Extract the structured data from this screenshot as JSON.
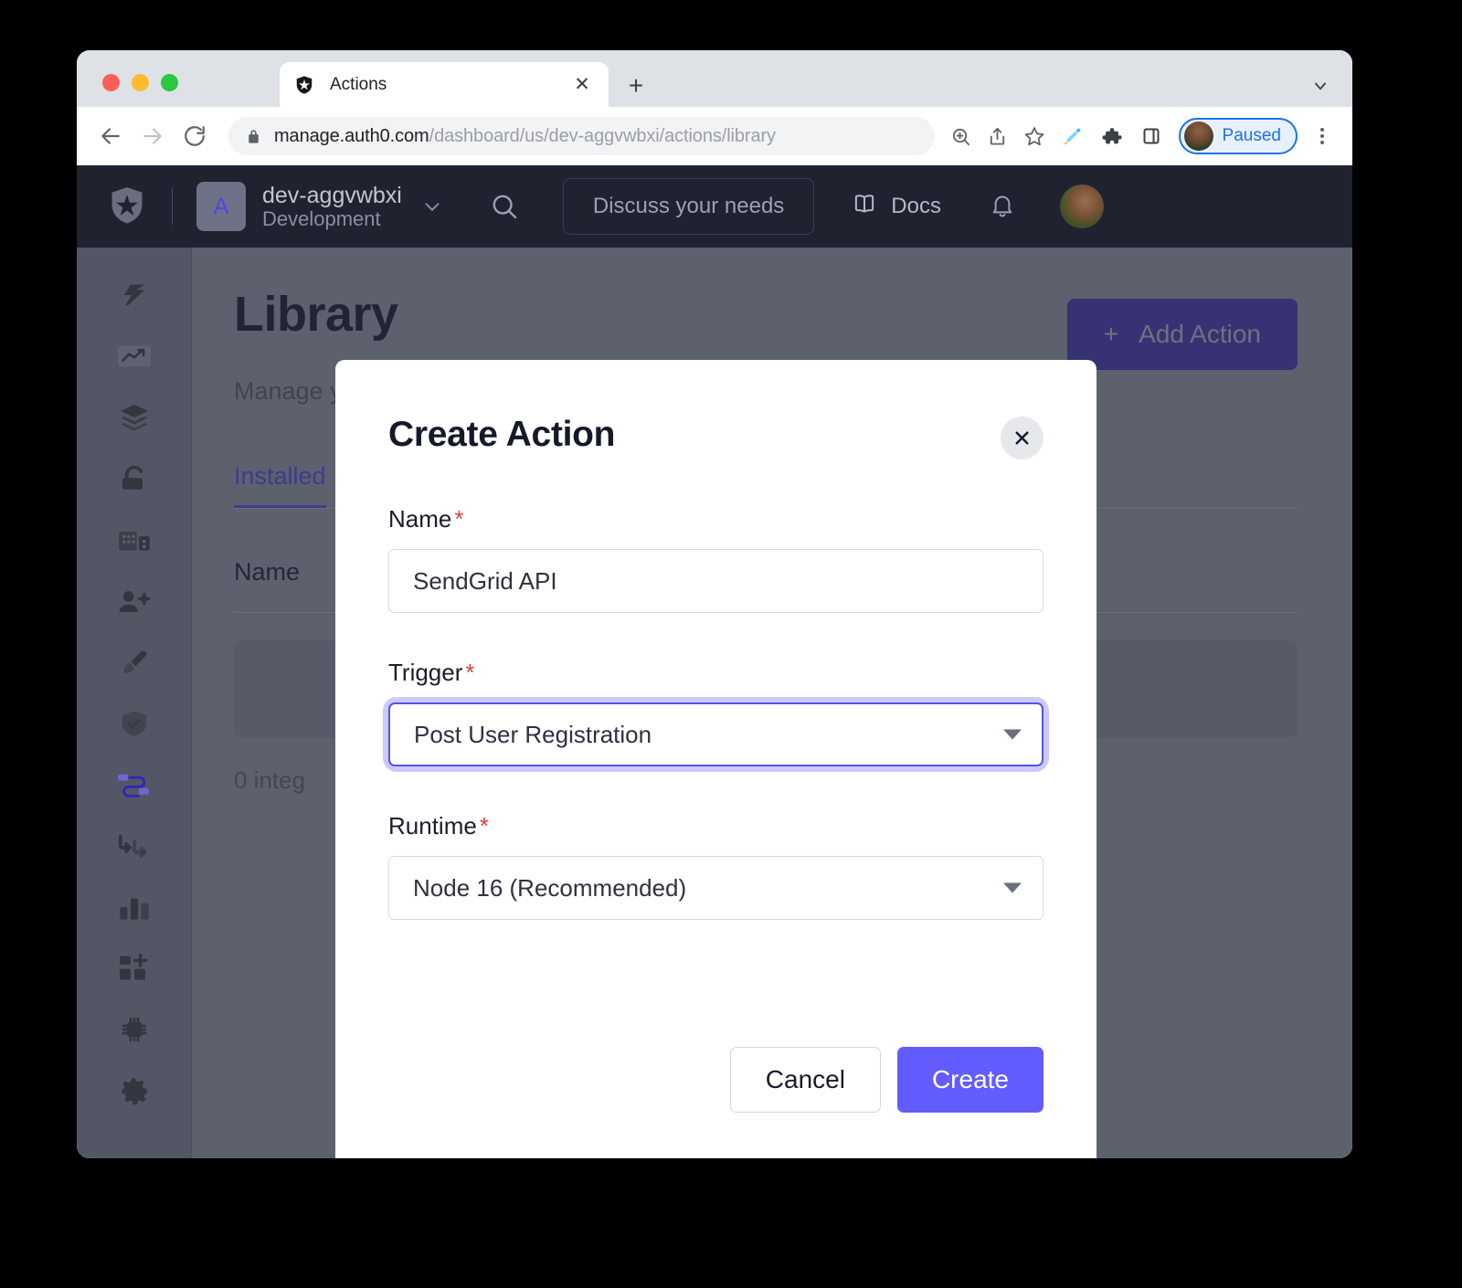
{
  "browser": {
    "tab": {
      "title": "Actions",
      "favicon": "auth0-shield-icon",
      "close": "✕"
    },
    "new_tab": "+",
    "tab_overflow": "chevron-down-icon",
    "nav": {
      "back": "←",
      "forward": "→",
      "reload": "⟳"
    },
    "omnibox": {
      "lock": "lock-icon",
      "url_domain": "manage.auth0.com",
      "url_path": "/dashboard/us/dev-aggvwbxi/actions/library",
      "zoom_icon": "zoom-in-icon",
      "share_icon": "share-icon",
      "bookmark_icon": "star-icon"
    },
    "extensions": {
      "highlighter": "highlighter-icon",
      "puzzle": "extensions-puzzle-icon",
      "side_panel": "side-panel-icon"
    },
    "profile": {
      "label": "Paused",
      "avatar": "user-avatar"
    },
    "menu": "kebab-menu-icon"
  },
  "app": {
    "logo": "auth0-logo-icon",
    "tenant": {
      "badge_letter": "A",
      "name": "dev-aggvwbxi",
      "environment": "Development",
      "caret": "chevron-down-icon"
    },
    "search_icon": "search-icon",
    "discuss_button": "Discuss your needs",
    "docs": {
      "label": "Docs",
      "icon": "book-icon"
    },
    "notifications_icon": "bell-icon",
    "user_avatar": "user-avatar"
  },
  "sidebar": {
    "items": [
      {
        "name": "getting-started",
        "icon": "lightning-bolt-icon",
        "active": false
      },
      {
        "name": "activity",
        "icon": "trend-chart-icon",
        "active": false
      },
      {
        "name": "applications",
        "icon": "layers-icon",
        "active": false
      },
      {
        "name": "authentication",
        "icon": "lock-icon",
        "active": false
      },
      {
        "name": "organizations",
        "icon": "buildings-icon",
        "active": false
      },
      {
        "name": "user-management",
        "icon": "user-gear-icon",
        "active": false
      },
      {
        "name": "branding",
        "icon": "paintbrush-icon",
        "active": false
      },
      {
        "name": "security",
        "icon": "shield-check-icon",
        "active": false
      },
      {
        "name": "actions",
        "icon": "actions-flow-icon",
        "active": true
      },
      {
        "name": "auth-pipeline",
        "icon": "pipeline-arrows-icon",
        "active": false
      },
      {
        "name": "monitoring",
        "icon": "bar-chart-icon",
        "active": false
      },
      {
        "name": "marketplace",
        "icon": "add-blocks-icon",
        "active": false
      },
      {
        "name": "extensions",
        "icon": "cpu-chip-icon",
        "active": false
      },
      {
        "name": "settings",
        "icon": "gear-icon",
        "active": false
      }
    ]
  },
  "main": {
    "title": "Library",
    "subtitle": "Manage y",
    "tabs": [
      {
        "label": "Installed",
        "active": true
      }
    ],
    "table": {
      "columns": [
        "Name"
      ],
      "footer": "0 integ"
    },
    "add_action_button": {
      "plus": "+",
      "label": "Add Action"
    }
  },
  "modal": {
    "title": "Create Action",
    "close_icon": "close-icon",
    "fields": {
      "name": {
        "label": "Name",
        "required": "*",
        "value": "SendGrid API"
      },
      "trigger": {
        "label": "Trigger",
        "required": "*",
        "value": "Post User Registration",
        "caret": "chevron-down-icon",
        "focused": true
      },
      "runtime": {
        "label": "Runtime",
        "required": "*",
        "value": "Node 16 (Recommended)",
        "caret": "chevron-down-icon",
        "focused": false
      }
    },
    "cancel_label": "Cancel",
    "create_label": "Create"
  },
  "colors": {
    "accent": "#635dff",
    "focus_ring": "#ccc9fb",
    "required": "#e03e3e",
    "topbar_bg": "#202230",
    "sidebar_bg": "#535765"
  }
}
